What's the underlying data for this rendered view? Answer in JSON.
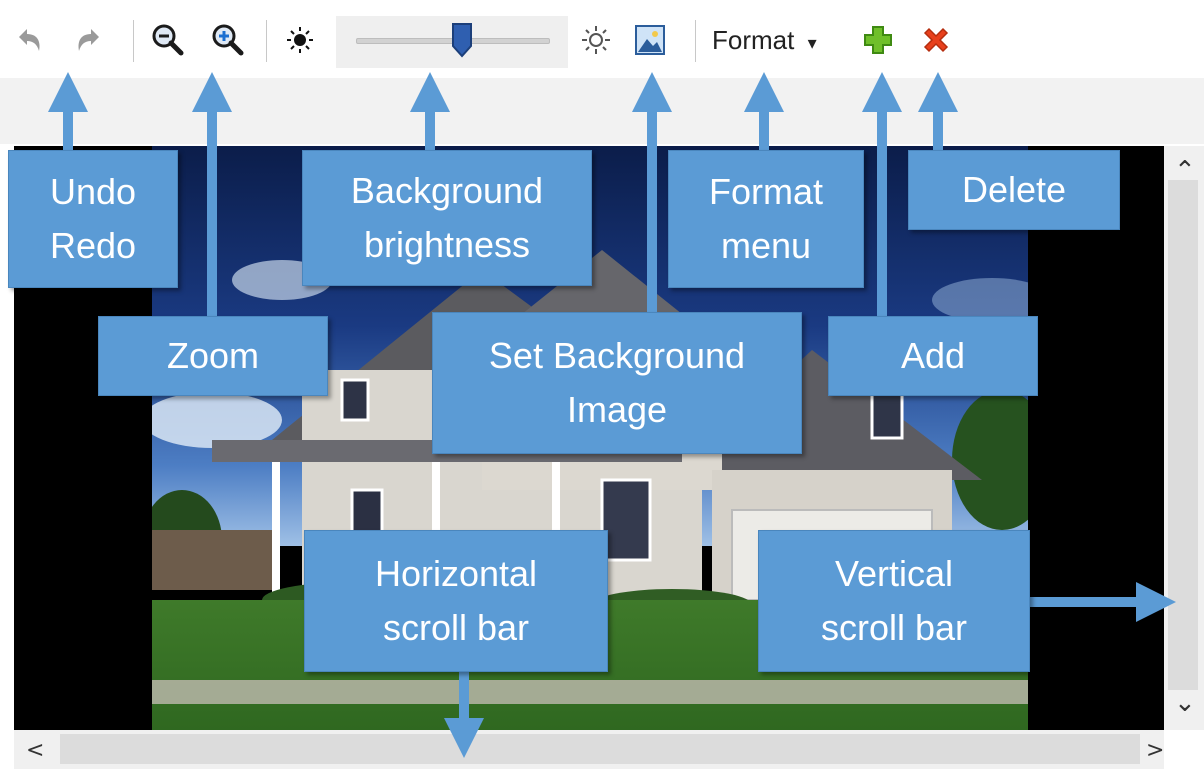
{
  "toolbar": {
    "format_label": "Format",
    "format_caret": "▾",
    "icons": [
      "undo-icon",
      "redo-icon",
      "zoom-out-icon",
      "zoom-in-icon",
      "brightness-low-icon",
      "brightness-high-icon",
      "background-image-icon",
      "add-icon",
      "delete-icon"
    ],
    "slider": {
      "value": 0.55
    },
    "colors": {
      "add": "#6fbf2a",
      "delete": "#e8401c",
      "slider_thumb": "#2f5fb0"
    }
  },
  "scrollbars": {
    "up": "⌃",
    "down": "⌄",
    "left": "<",
    "right": ">"
  },
  "callouts": {
    "undo_redo": [
      "Undo",
      "Redo"
    ],
    "zoom": "Zoom",
    "background_brightness": [
      "Background",
      "brightness"
    ],
    "set_background_image": [
      "Set Background",
      "Image"
    ],
    "format_menu": [
      "Format",
      "menu"
    ],
    "add": "Add",
    "delete": "Delete",
    "horizontal_scroll_bar": [
      "Horizontal",
      "scroll bar"
    ],
    "vertical_scroll_bar": [
      "Vertical",
      "scroll bar"
    ]
  },
  "colors": {
    "callout": "#5b9bd5"
  }
}
